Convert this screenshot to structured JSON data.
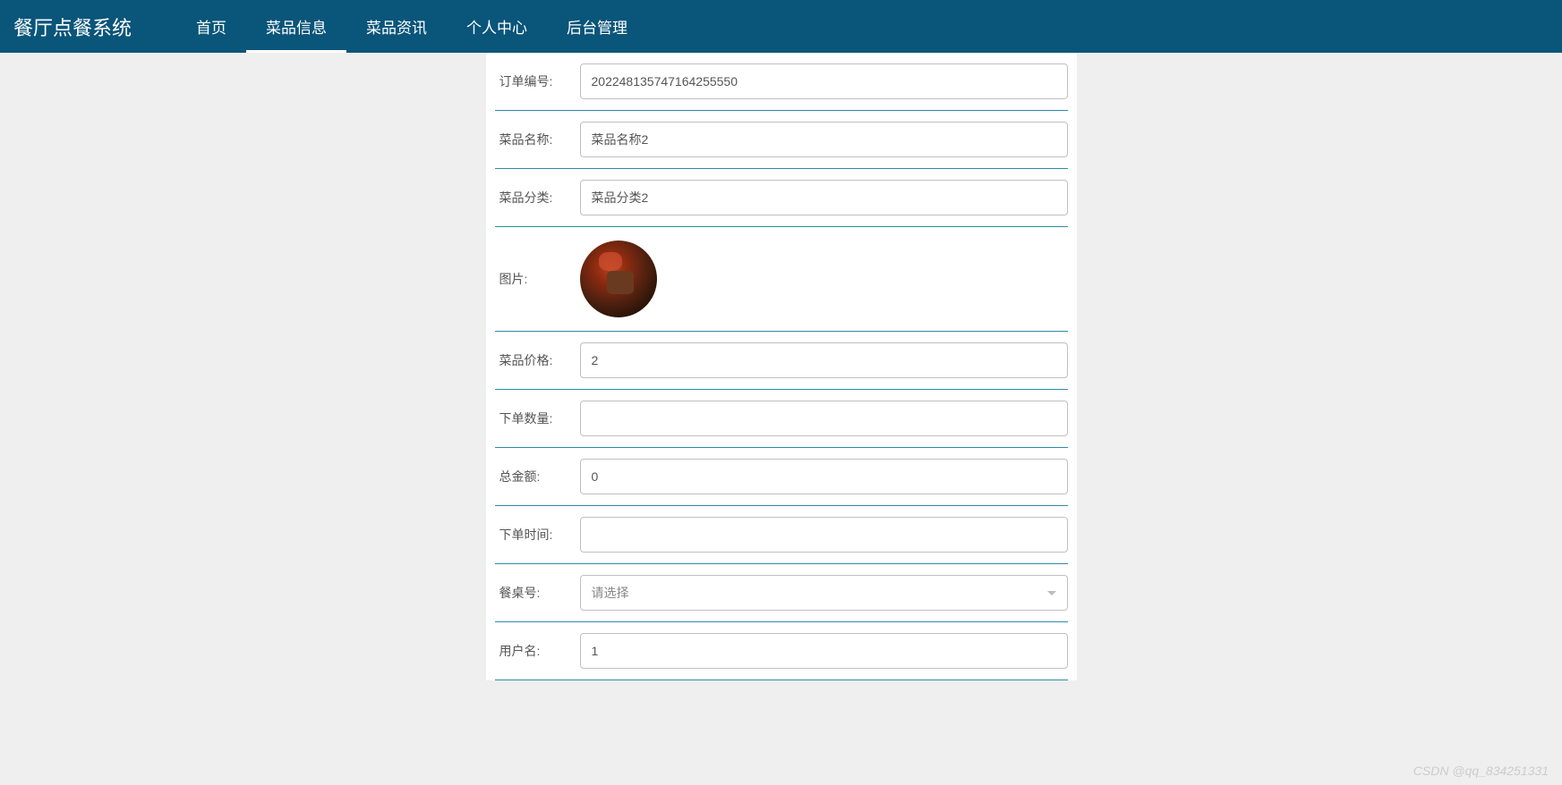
{
  "header": {
    "title": "餐厅点餐系统",
    "nav": [
      {
        "label": "首页",
        "active": false
      },
      {
        "label": "菜品信息",
        "active": true
      },
      {
        "label": "菜品资讯",
        "active": false
      },
      {
        "label": "个人中心",
        "active": false
      },
      {
        "label": "后台管理",
        "active": false
      }
    ]
  },
  "form": {
    "orderNo": {
      "label": "订单编号:",
      "value": "202248135747164255550"
    },
    "dishName": {
      "label": "菜品名称:",
      "value": "菜品名称2"
    },
    "dishCategory": {
      "label": "菜品分类:",
      "value": "菜品分类2"
    },
    "image": {
      "label": "图片:"
    },
    "dishPrice": {
      "label": "菜品价格:",
      "value": "2"
    },
    "orderQty": {
      "label": "下单数量:",
      "value": ""
    },
    "totalAmount": {
      "label": "总金额:",
      "value": "0"
    },
    "orderTime": {
      "label": "下单时间:",
      "value": ""
    },
    "tableNo": {
      "label": "餐桌号:",
      "placeholder": "请选择"
    },
    "username": {
      "label": "用户名:",
      "value": "1"
    }
  },
  "watermark": "CSDN @qq_834251331"
}
